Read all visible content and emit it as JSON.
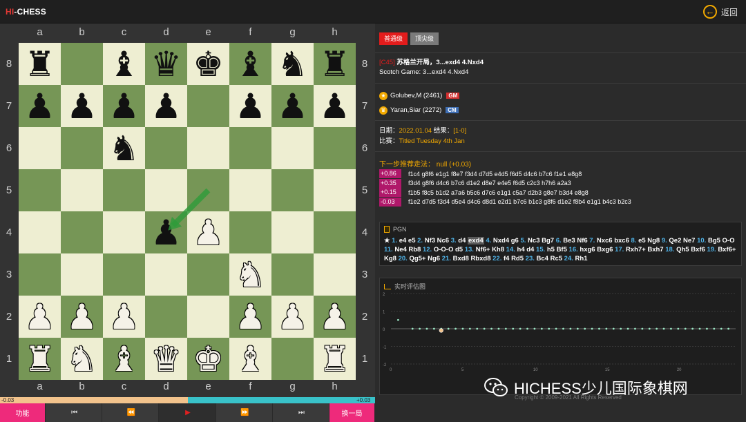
{
  "app": {
    "logo_hi": "HI",
    "logo_rest": "-CHESS",
    "back_label": "返回"
  },
  "board": {
    "files": [
      "a",
      "b",
      "c",
      "d",
      "e",
      "f",
      "g",
      "h"
    ],
    "ranks": [
      "8",
      "7",
      "6",
      "5",
      "4",
      "3",
      "2",
      "1"
    ],
    "position": [
      [
        "br",
        "",
        "bb",
        "bq",
        "bk",
        "bb",
        "bn",
        "br"
      ],
      [
        "bp",
        "bp",
        "bp",
        "bp",
        "",
        "bp",
        "bp",
        "bp"
      ],
      [
        "",
        "",
        "bn",
        "",
        "",
        "",
        "",
        ""
      ],
      [
        "",
        "",
        "",
        "",
        "",
        "",
        "",
        ""
      ],
      [
        "",
        "",
        "",
        "bp",
        "wp",
        "",
        "",
        ""
      ],
      [
        "",
        "",
        "",
        "",
        "",
        "wn",
        "",
        ""
      ],
      [
        "wp",
        "wp",
        "wp",
        "",
        "",
        "wp",
        "wp",
        "wp"
      ],
      [
        "wr",
        "wn",
        "wb",
        "wq",
        "wk",
        "wb",
        "",
        "wr"
      ]
    ],
    "last_move_arrow": {
      "from": "e5",
      "to": "d4",
      "color": "#2e9b3a"
    }
  },
  "eval_bar": {
    "left_label": "-0.03",
    "right_label": "+0.03",
    "white_share": 0.5
  },
  "controls": {
    "menu": "功能",
    "first": "⏮",
    "prev": "⏪",
    "play": "▶",
    "next": "⏩",
    "last": "⏭",
    "switch": "换一局"
  },
  "level_tabs": [
    {
      "label": "普通级"
    },
    {
      "label": "顶尖级"
    }
  ],
  "opening": {
    "eco": "[C45]",
    "name_cn": "苏格兰开局，3...exd4 4.Nxd4",
    "name_en": "Scotch Game: 3...exd4 4.Nxd4"
  },
  "players": [
    {
      "name": "Golubev,M (2461)",
      "title": "GM"
    },
    {
      "name": "Yaran,Siar (2272)",
      "title": "CM"
    }
  ],
  "meta": {
    "date_label": "日期：",
    "date": "2022.01.04",
    "result_label": " 结果：",
    "result": "[1-0]",
    "event_label": "比赛：",
    "event": "Titled Tuesday 4th Jan"
  },
  "recommend": {
    "title": "下一步推荐走法：  null (+0.03)",
    "lines": [
      {
        "score": "+0.86",
        "moves": "f1c4 g8f6 e1g1 f8e7 f3d4 d7d5 e4d5 f6d5 d4c6 b7c6 f1e1 e8g8"
      },
      {
        "score": "+0.35",
        "moves": "f3d4 g8f6 d4c6 b7c6 d1e2 d8e7 e4e5 f6d5 c2c3 h7h6 a2a3"
      },
      {
        "score": "+0.15",
        "moves": "f1b5 f8c5 b1d2 a7a6 b5c6 d7c6 e1g1 c5a7 d2b3 g8e7 b3d4 e8g8"
      },
      {
        "score": "-0.03",
        "moves": "f1e2 d7d5 f3d4 d5e4 d4c6 d8d1 e2d1 b7c6 b1c3 g8f6 d1e2 f8b4 e1g1 b4c3 b2c3"
      }
    ]
  },
  "pgn": {
    "title": "PGN",
    "star": "★",
    "moves": [
      {
        "n": "1.",
        "m": "e4 e5"
      },
      {
        "n": "2.",
        "m": "Nf3 Nc6"
      },
      {
        "n": "3.",
        "m": "d4",
        "cur": "exd4"
      },
      {
        "n": "4.",
        "m": "Nxd4 g6"
      },
      {
        "n": "5.",
        "m": "Nc3 Bg7"
      },
      {
        "n": "6.",
        "m": "Be3 Nf6"
      },
      {
        "n": "7.",
        "m": "Nxc6 bxc6"
      },
      {
        "n": "8.",
        "m": "e5 Ng8"
      },
      {
        "n": "9.",
        "m": "Qe2 Ne7"
      },
      {
        "n": "10.",
        "m": "Bg5 O-O"
      },
      {
        "n": "11.",
        "m": "Ne4 Rb8"
      },
      {
        "n": "12.",
        "m": "O-O-O d5"
      },
      {
        "n": "13.",
        "m": "Nf6+ Kh8"
      },
      {
        "n": "14.",
        "m": "h4 d4"
      },
      {
        "n": "15.",
        "m": "h5 Bf5"
      },
      {
        "n": "16.",
        "m": "hxg6 Bxg6"
      },
      {
        "n": "17.",
        "m": "Rxh7+ Bxh7"
      },
      {
        "n": "18.",
        "m": "Qh5 Bxf6"
      },
      {
        "n": "19.",
        "m": "Bxf6+ Kg8"
      },
      {
        "n": "20.",
        "m": "Qg5+ Ng6"
      },
      {
        "n": "21.",
        "m": "Bxd8 Rbxd8"
      },
      {
        "n": "22.",
        "m": "f4 Rd5"
      },
      {
        "n": "23.",
        "m": "Bc4 Rc5"
      },
      {
        "n": "24.",
        "m": "Rh1"
      }
    ]
  },
  "chart_data": {
    "type": "scatter",
    "title": "实时评估图",
    "y_ticks": [
      "2",
      "1",
      "0",
      "-1",
      "-2"
    ],
    "x_ticks": [
      "0",
      "5",
      "10",
      "15",
      "20"
    ],
    "ylim": [
      -2,
      2
    ],
    "xlim": [
      0,
      24
    ],
    "grid": true,
    "current_index": 3,
    "x": [
      1,
      2,
      3,
      4,
      5,
      6,
      7,
      8,
      9,
      10,
      11,
      12,
      13,
      14,
      15,
      16,
      17,
      18,
      19,
      20,
      21,
      22,
      23,
      24,
      25,
      26,
      27,
      28,
      29,
      30,
      31,
      32,
      33,
      34,
      35,
      36,
      37,
      38,
      39,
      40,
      41,
      42,
      43,
      44,
      45,
      46,
      47,
      48
    ],
    "point_color": "#9be7c4",
    "current_color": "#f2c38c"
  },
  "footer": {
    "watermark": "HICHESS少儿国际象棋网",
    "copyright": "Copyright © 2009-2021 All Rights Reserved"
  }
}
